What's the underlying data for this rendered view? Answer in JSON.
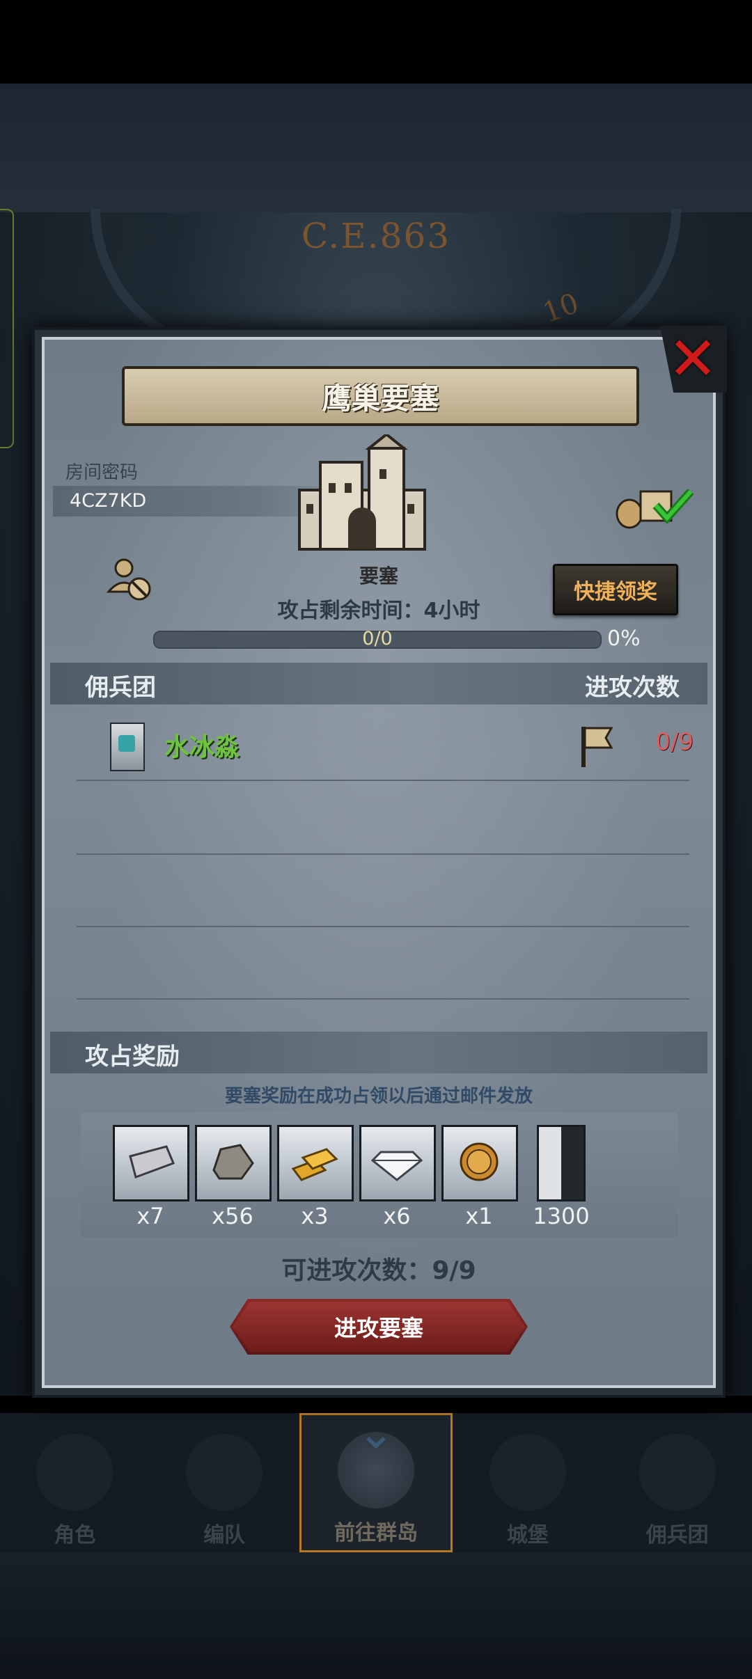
{
  "background": {
    "year_text": "C.E.863",
    "dial_number": "10"
  },
  "modal": {
    "title": "鹰巢要塞",
    "room": {
      "label": "房间密码",
      "code": "4CZ7KD"
    },
    "building_label": "要塞",
    "quick_claim_label": "快捷领奖",
    "time_remaining": "攻占剩余时间：4小时",
    "progress": {
      "text": "0/0",
      "percent_text": "0%",
      "value": 0
    },
    "columns": {
      "left": "佣兵团",
      "right": "进攻次数"
    },
    "guilds": [
      {
        "name": "水冰淼",
        "attacks": "0/9"
      }
    ],
    "rewards_header": "攻占奖励",
    "rewards_note": "要塞奖励在成功占领以后通过邮件发放",
    "rewards": [
      {
        "icon": "silver-bar-icon",
        "qty": "x7"
      },
      {
        "icon": "stone-ore-icon",
        "qty": "x56"
      },
      {
        "icon": "gold-bars-icon",
        "qty": "x3"
      },
      {
        "icon": "diamond-icon",
        "qty": "x6"
      },
      {
        "icon": "helmet-coin-icon",
        "qty": "x1"
      },
      {
        "icon": "bull-banner-icon",
        "qty": "1300"
      }
    ],
    "attempts_text": "可进攻次数：9/9",
    "attack_button_label": "进攻要塞"
  },
  "nav": {
    "items": [
      {
        "label": "角色"
      },
      {
        "label": "编队"
      },
      {
        "label": "前往群岛",
        "active": true
      },
      {
        "label": "城堡"
      },
      {
        "label": "佣兵团"
      }
    ]
  },
  "colors": {
    "guild_name": "#6fc43e",
    "attack_count": "#d96060",
    "quick_claim_text": "#f0b15b",
    "close": "#d11a1a"
  }
}
